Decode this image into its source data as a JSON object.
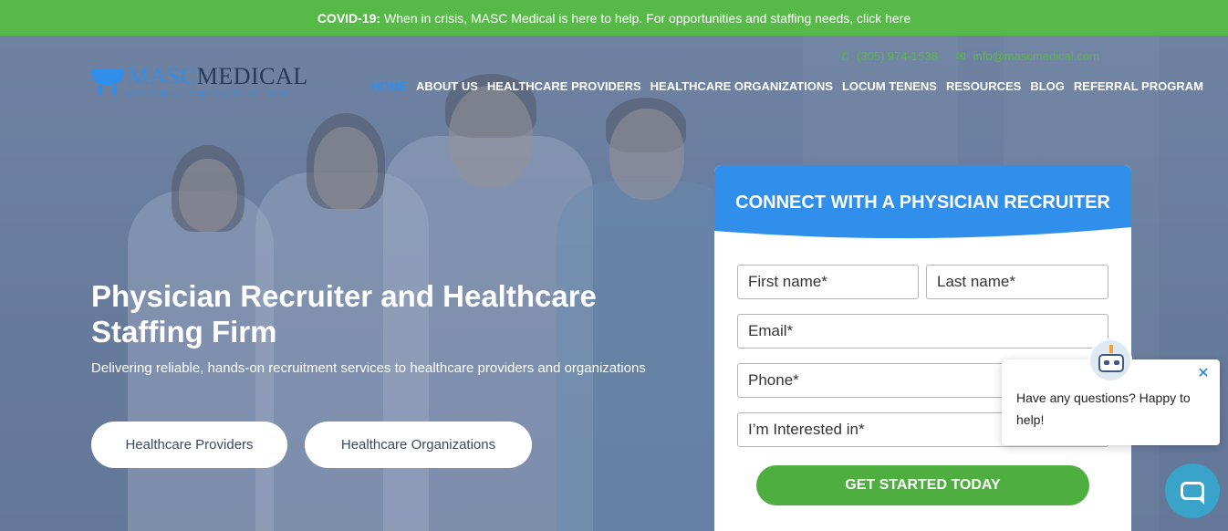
{
  "topbar": {
    "bold": "COVID-19:",
    "text": "When in crisis, MASC Medical is here to help. For opportunities and staffing needs, click here"
  },
  "contact": {
    "phone_icon": "phone-icon",
    "phone": "(305) 974-1538",
    "email_icon": "envelope-icon",
    "email": "info@mascmedical.com"
  },
  "logo": {
    "part1": "MASC",
    "part2": "MEDICAL",
    "tagline": "RECRUITMENT FIRM"
  },
  "nav": [
    {
      "label": "HOME",
      "active": true
    },
    {
      "label": "ABOUT US"
    },
    {
      "label": "HEALTHCARE PROVIDERS"
    },
    {
      "label": "HEALTHCARE ORGANIZATIONS"
    },
    {
      "label": "LOCUM TENENS"
    },
    {
      "label": "RESOURCES"
    },
    {
      "label": "BLOG"
    },
    {
      "label": "REFERRAL PROGRAM"
    }
  ],
  "hero": {
    "title": "Physician Recruiter and Healthcare Staffing Firm",
    "subtitle": "Delivering reliable, hands-on recruitment services to healthcare providers and organizations",
    "btn_providers": "Healthcare Providers",
    "btn_organizations": "Healthcare Organizations"
  },
  "form": {
    "title": "CONNECT WITH A PHYSICIAN RECRUITER",
    "first_name": "First name*",
    "last_name": "Last name*",
    "email": "Email*",
    "phone": "Phone*",
    "interested": "I’m Interested in*",
    "submit": "GET STARTED TODAY"
  },
  "chat": {
    "message": "Have any questions? Happy to help!",
    "close_icon": "close-icon",
    "fab_icon": "chat-bubble-icon"
  },
  "colors": {
    "green": "#57b947",
    "blue": "#2f8fea",
    "chat": "#3aa3c9"
  }
}
